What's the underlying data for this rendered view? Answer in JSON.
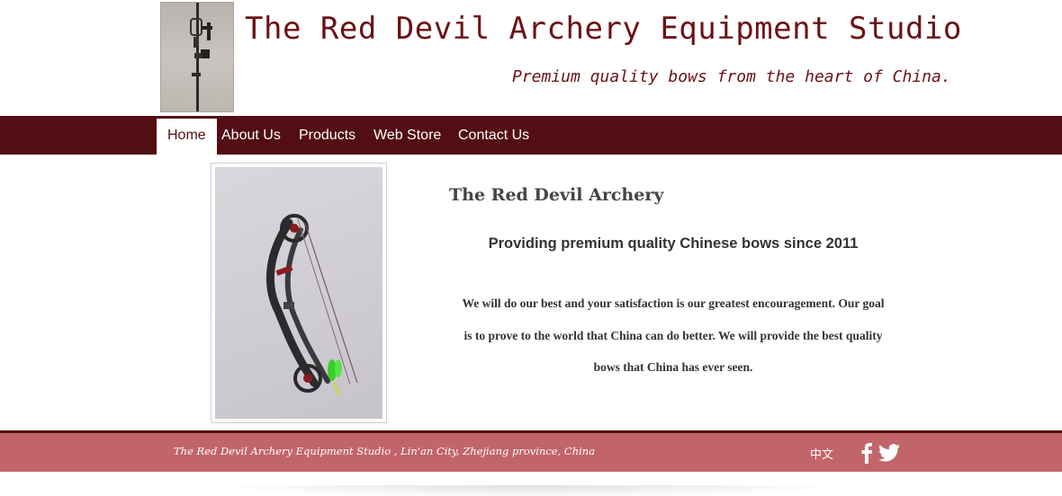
{
  "header": {
    "title": "The Red Devil Archery Equipment Studio",
    "tagline": "Premium quality bows from the heart of China."
  },
  "nav": {
    "items": [
      {
        "label": "Home",
        "active": true
      },
      {
        "label": "About Us",
        "active": false
      },
      {
        "label": "Products",
        "active": false
      },
      {
        "label": "Web Store",
        "active": false
      },
      {
        "label": "Contact Us",
        "active": false
      }
    ]
  },
  "main": {
    "title": "The Red Devil Archery",
    "subtitle": "Providing premium quality Chinese bows since 2011",
    "body_lines": [
      "We will do our best and your satisfaction is our greatest encouragement. Our goal",
      "is to prove to the world that China can do better. We will provide the best quality",
      "bows that China has ever seen."
    ]
  },
  "footer": {
    "address": "The Red Devil Archery Equipment Studio , Lin'an City, Zhejiang province, China",
    "language_link": "中文",
    "social_icons": [
      "facebook-icon",
      "twitter-icon"
    ]
  },
  "colors": {
    "brand_dark": "#530e14",
    "title_text": "#6b1216",
    "footer_bg": "#c1656a"
  }
}
